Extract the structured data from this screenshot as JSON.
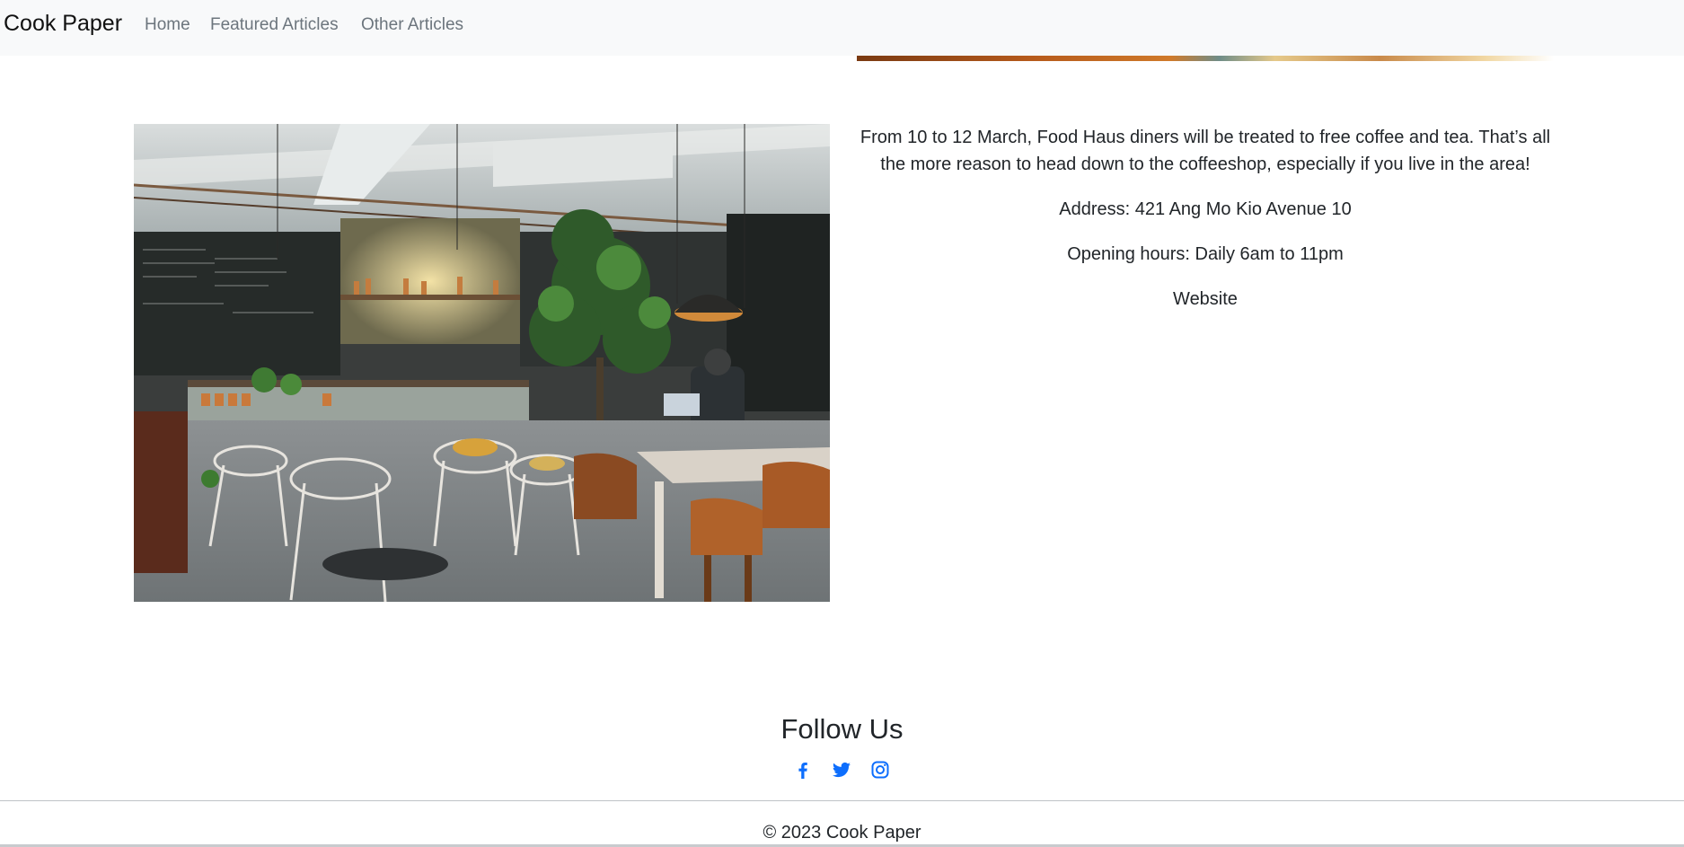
{
  "navbar": {
    "brand": "Cook Paper",
    "links": [
      "Home",
      "Featured Articles",
      "Other Articles"
    ]
  },
  "article": {
    "intro": "From 10 to 12 March, Food Haus diners will be treated to free coffee and tea. That’s all the more reason to head down to the coffeeshop, especially if you live in the area!",
    "address": "Address: 421 Ang Mo Kio Avenue 10",
    "hours": "Opening hours: Daily 6am to 11pm",
    "website_label": "Website"
  },
  "footer": {
    "follow_title": "Follow Us",
    "social_icons": [
      "facebook-icon",
      "twitter-icon",
      "instagram-icon"
    ],
    "copyright": "© 2023 Cook Paper"
  },
  "colors": {
    "navbar_bg": "#f8f9fa",
    "link_muted": "#6c757d",
    "social_blue": "#0d6efd"
  }
}
